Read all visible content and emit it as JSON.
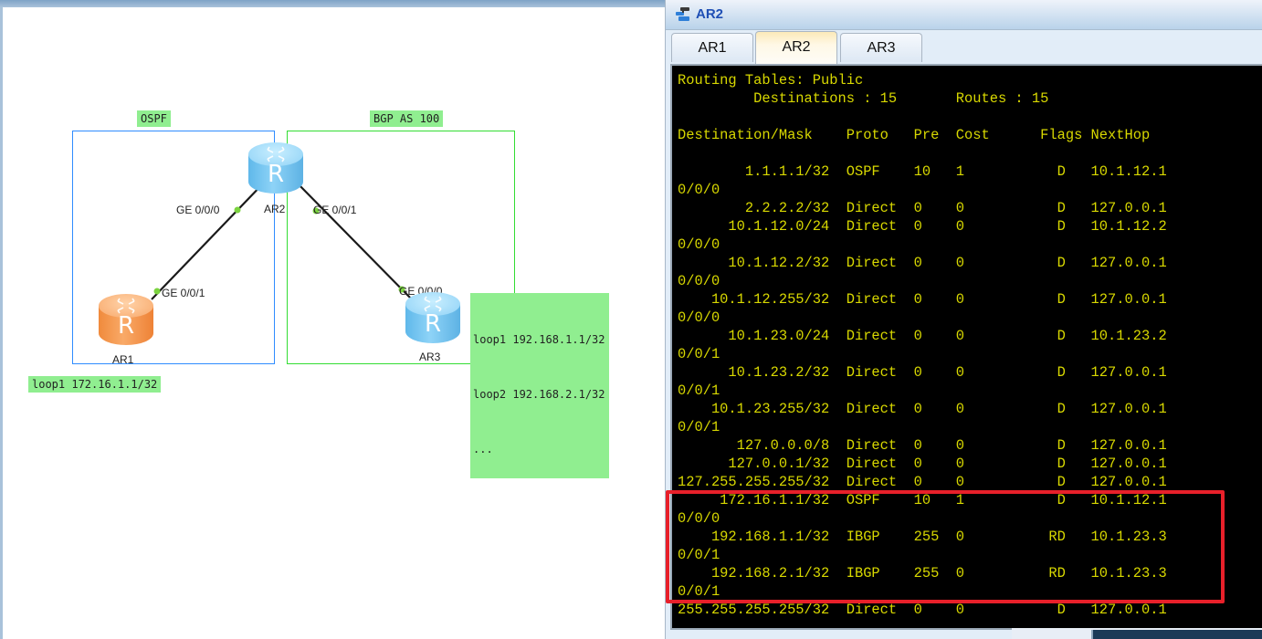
{
  "topology": {
    "areas": [
      {
        "name": "ospf",
        "label": "OSPF",
        "color": "#2f8cff"
      },
      {
        "name": "bgp",
        "label": "BGP AS 100",
        "color": "#33dd33"
      }
    ],
    "devices": [
      {
        "name": "AR1",
        "color": "orange"
      },
      {
        "name": "AR2",
        "color": "blue"
      },
      {
        "name": "AR3",
        "color": "blue"
      }
    ],
    "router_glyph": "R",
    "ports": {
      "ar2_ge000": "GE 0/0/0",
      "ar2_ge001": "GE 0/0/1",
      "ar1_ge001": "GE 0/0/1",
      "ar3_ge000": "GE 0/0/0"
    },
    "annotations": {
      "ar1_loopback": "loop1 172.16.1.1/32",
      "ar3_loopbacks": [
        "loop1 192.168.1.1/32",
        "loop2 192.168.2.1/32",
        "..."
      ]
    },
    "link_color": "#1a1a1a",
    "port_dot_color": "#7bd33f"
  },
  "console": {
    "title": "AR2",
    "title_icon": "terminal-icon",
    "tabs": [
      {
        "label": "AR1",
        "active": false
      },
      {
        "label": "AR2",
        "active": true
      },
      {
        "label": "AR3",
        "active": false
      }
    ],
    "text_color": "#d8d800",
    "background": "#000000",
    "highlight_color": "#e8202a",
    "routing_table": {
      "header": "Routing Tables: Public",
      "summary": "Destinations : 15       Routes : 15",
      "destinations": 15,
      "routes": 15,
      "columns": [
        "Destination/Mask",
        "Proto",
        "Pre",
        "Cost",
        "Flags",
        "NextHop"
      ],
      "rows": [
        {
          "dest": "1.1.1.1/32",
          "proto": "OSPF",
          "pre": "10",
          "cost": "1",
          "flags": "D",
          "nexthop": "10.1.12.1",
          "iface_tail": "0/0/0"
        },
        {
          "dest": "2.2.2.2/32",
          "proto": "Direct",
          "pre": "0",
          "cost": "0",
          "flags": "D",
          "nexthop": "127.0.0.1",
          "iface_tail": ""
        },
        {
          "dest": "10.1.12.0/24",
          "proto": "Direct",
          "pre": "0",
          "cost": "0",
          "flags": "D",
          "nexthop": "10.1.12.2",
          "iface_tail": "0/0/0"
        },
        {
          "dest": "10.1.12.2/32",
          "proto": "Direct",
          "pre": "0",
          "cost": "0",
          "flags": "D",
          "nexthop": "127.0.0.1",
          "iface_tail": "0/0/0"
        },
        {
          "dest": "10.1.12.255/32",
          "proto": "Direct",
          "pre": "0",
          "cost": "0",
          "flags": "D",
          "nexthop": "127.0.0.1",
          "iface_tail": "0/0/0"
        },
        {
          "dest": "10.1.23.0/24",
          "proto": "Direct",
          "pre": "0",
          "cost": "0",
          "flags": "D",
          "nexthop": "10.1.23.2",
          "iface_tail": "0/0/1"
        },
        {
          "dest": "10.1.23.2/32",
          "proto": "Direct",
          "pre": "0",
          "cost": "0",
          "flags": "D",
          "nexthop": "127.0.0.1",
          "iface_tail": "0/0/1"
        },
        {
          "dest": "10.1.23.255/32",
          "proto": "Direct",
          "pre": "0",
          "cost": "0",
          "flags": "D",
          "nexthop": "127.0.0.1",
          "iface_tail": "0/0/1"
        },
        {
          "dest": "127.0.0.0/8",
          "proto": "Direct",
          "pre": "0",
          "cost": "0",
          "flags": "D",
          "nexthop": "127.0.0.1",
          "iface_tail": ""
        },
        {
          "dest": "127.0.0.1/32",
          "proto": "Direct",
          "pre": "0",
          "cost": "0",
          "flags": "D",
          "nexthop": "127.0.0.1",
          "iface_tail": ""
        },
        {
          "dest": "127.255.255.255/32",
          "proto": "Direct",
          "pre": "0",
          "cost": "0",
          "flags": "D",
          "nexthop": "127.0.0.1",
          "iface_tail": ""
        },
        {
          "dest": "172.16.1.1/32",
          "proto": "OSPF",
          "pre": "10",
          "cost": "1",
          "flags": "D",
          "nexthop": "10.1.12.1",
          "iface_tail": "0/0/0",
          "highlighted": true
        },
        {
          "dest": "192.168.1.1/32",
          "proto": "IBGP",
          "pre": "255",
          "cost": "0",
          "flags": "RD",
          "nexthop": "10.1.23.3",
          "iface_tail": "0/0/1",
          "highlighted": true
        },
        {
          "dest": "192.168.2.1/32",
          "proto": "IBGP",
          "pre": "255",
          "cost": "0",
          "flags": "RD",
          "nexthop": "10.1.23.3",
          "iface_tail": "0/0/1",
          "highlighted": true
        },
        {
          "dest": "255.255.255.255/32",
          "proto": "Direct",
          "pre": "0",
          "cost": "0",
          "flags": "D",
          "nexthop": "127.0.0.1",
          "iface_tail": ""
        }
      ]
    }
  }
}
